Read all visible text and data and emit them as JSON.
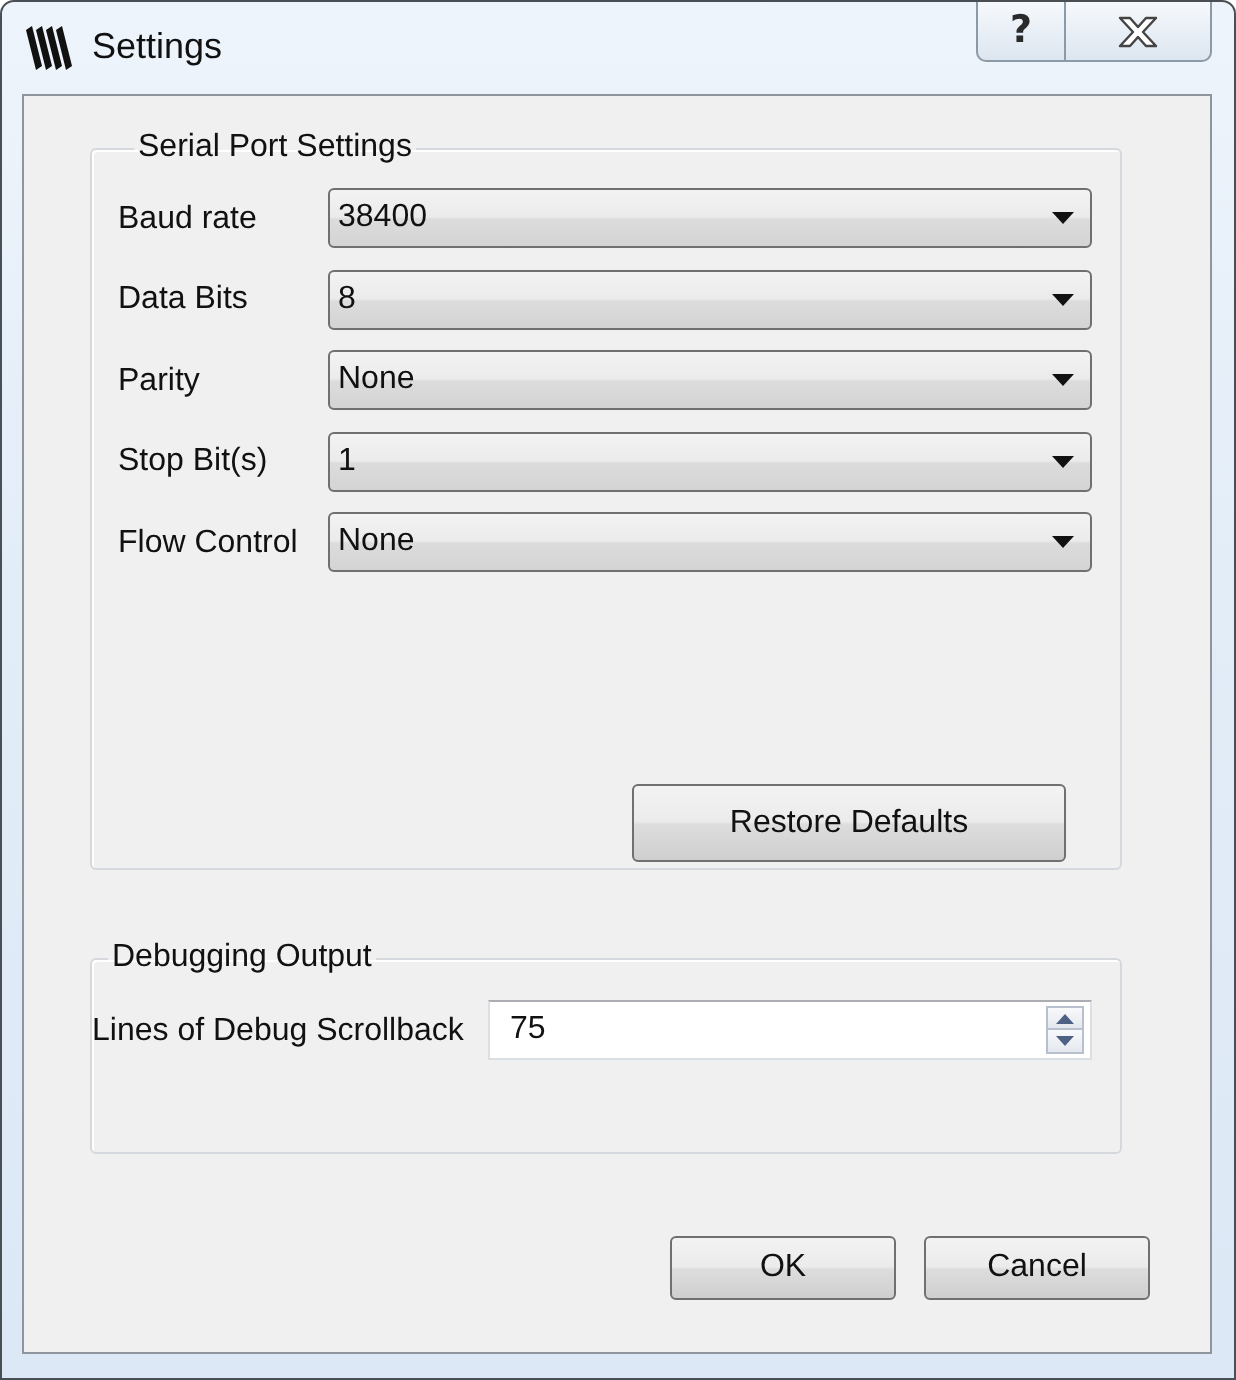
{
  "window": {
    "title": "Settings",
    "help_button": "?"
  },
  "serial_port_settings": {
    "title": "Serial Port Settings",
    "fields": [
      {
        "label": "Baud rate",
        "value": "38400"
      },
      {
        "label": "Data Bits",
        "value": "8"
      },
      {
        "label": "Parity",
        "value": "None"
      },
      {
        "label": "Stop Bit(s)",
        "value": "1"
      },
      {
        "label": "Flow Control",
        "value": "None"
      }
    ],
    "restore_button": "Restore Defaults"
  },
  "debugging_output": {
    "title": "Debugging Output",
    "scrollback": {
      "label": "Lines of Debug Scrollback",
      "value": "75"
    }
  },
  "buttons": [
    "OK",
    "Cancel"
  ]
}
